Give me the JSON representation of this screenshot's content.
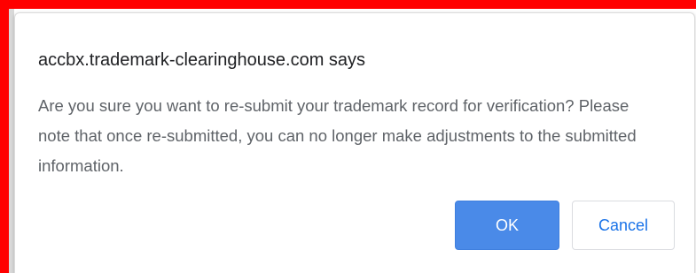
{
  "dialog": {
    "title": "accbx.trademark-clearinghouse.com says",
    "message": "Are you sure you want to re-submit your trademark record for verification? Please note that once re-submitted, you can no longer make adjustments to the submitted information.",
    "ok_label": "OK",
    "cancel_label": "Cancel"
  },
  "colors": {
    "highlight_frame": "#ff0000",
    "ok_button": "#4a8ae8",
    "cancel_text": "#1a73e8"
  }
}
